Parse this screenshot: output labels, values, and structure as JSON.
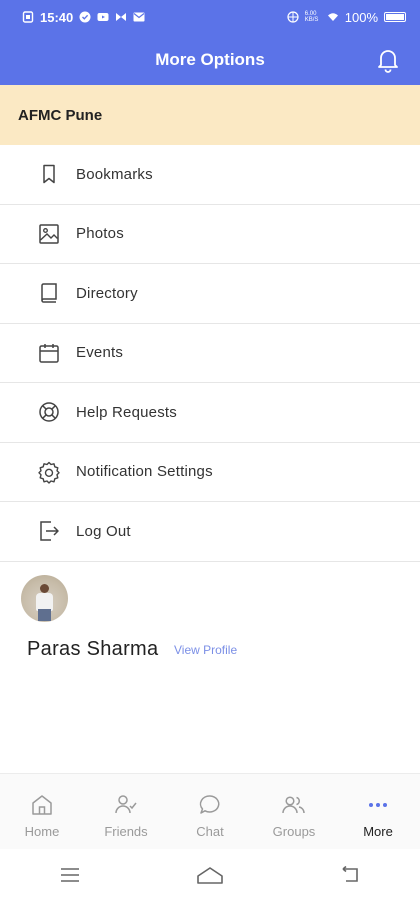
{
  "status_bar": {
    "time": "15:40",
    "network": "6.00 KB/S",
    "battery": "100%"
  },
  "header": {
    "title": "More Options",
    "bell_icon": "bell-icon"
  },
  "org": {
    "name": "AFMC Pune"
  },
  "menu": {
    "items": [
      {
        "label": "Bookmarks",
        "icon": "bookmark-icon"
      },
      {
        "label": "Photos",
        "icon": "photo-icon"
      },
      {
        "label": "Directory",
        "icon": "book-icon"
      },
      {
        "label": "Events",
        "icon": "calendar-icon"
      },
      {
        "label": "Help Requests",
        "icon": "lifebuoy-icon"
      },
      {
        "label": "Notification Settings",
        "icon": "gear-icon"
      },
      {
        "label": "Log Out",
        "icon": "logout-icon"
      }
    ]
  },
  "profile": {
    "name": "Paras Sharma",
    "view_profile": "View Profile"
  },
  "bottom_nav": {
    "items": [
      {
        "label": "Home",
        "icon": "home-icon"
      },
      {
        "label": "Friends",
        "icon": "friends-icon"
      },
      {
        "label": "Chat",
        "icon": "chat-icon"
      },
      {
        "label": "Groups",
        "icon": "groups-icon"
      },
      {
        "label": "More",
        "icon": "more-dots-icon",
        "active": true
      }
    ]
  },
  "colors": {
    "primary": "#5b73e8",
    "banner": "#fbe9c4",
    "link": "#7b8fe6"
  }
}
